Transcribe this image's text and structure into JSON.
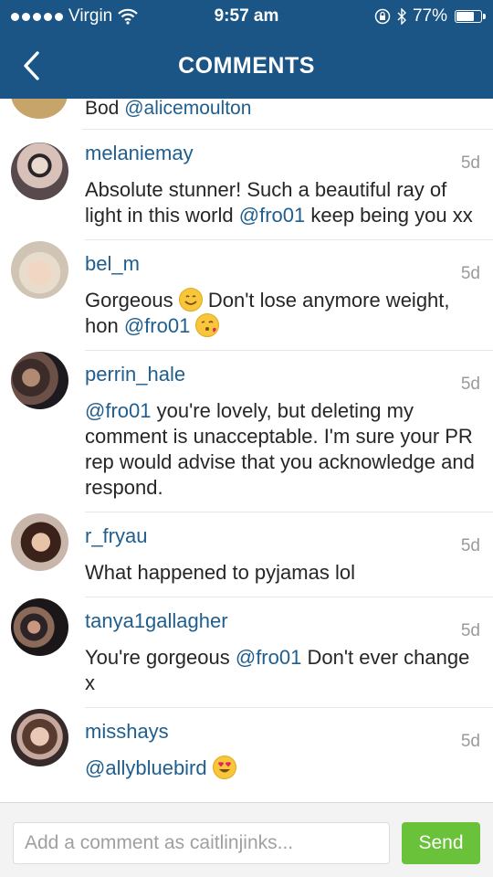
{
  "status_bar": {
    "carrier": "Virgin",
    "time": "9:57 am",
    "battery": "77%",
    "battery_level": 0.77
  },
  "nav": {
    "title": "COMMENTS",
    "back_icon": "chevron-left-icon"
  },
  "partial_comment": {
    "text_prefix": "Bod ",
    "mention": "@alicemoulton"
  },
  "comments": [
    {
      "username": "melaniemay",
      "time": "5d",
      "t1": "Absolute stunner! Such a beautiful ray of light in this world ",
      "m1": "@fro01",
      "t2": " keep being you xx"
    },
    {
      "username": "bel_m",
      "time": "5d",
      "t1": "Gorgeous ",
      "e1": "smiling-face-emoji",
      "t2": " Don't lose anymore weight, hon ",
      "m1": "@fro01",
      "e2": "face-blowing-kiss-emoji"
    },
    {
      "username": "perrin_hale",
      "time": "5d",
      "m1": "@fro01",
      "t1": " you're lovely, but deleting my comment is unacceptable. I'm sure your PR rep would advise that you acknowledge and respond."
    },
    {
      "username": "r_fryau",
      "time": "5d",
      "t1": "What happened to pyjamas lol"
    },
    {
      "username": "tanya1gallagher",
      "time": "5d",
      "t1": "You're gorgeous ",
      "m1": "@fro01",
      "t2": "  Don't ever change x"
    },
    {
      "username": "misshays",
      "time": "5d",
      "m1": "@allybluebird",
      "e1": "heart-eyes-emoji"
    }
  ],
  "composer": {
    "placeholder": "Add a comment as caitlinjinks...",
    "send_label": "Send"
  },
  "colors": {
    "header": "#1a5585",
    "link": "#1f5e8e",
    "send": "#69c23a"
  }
}
